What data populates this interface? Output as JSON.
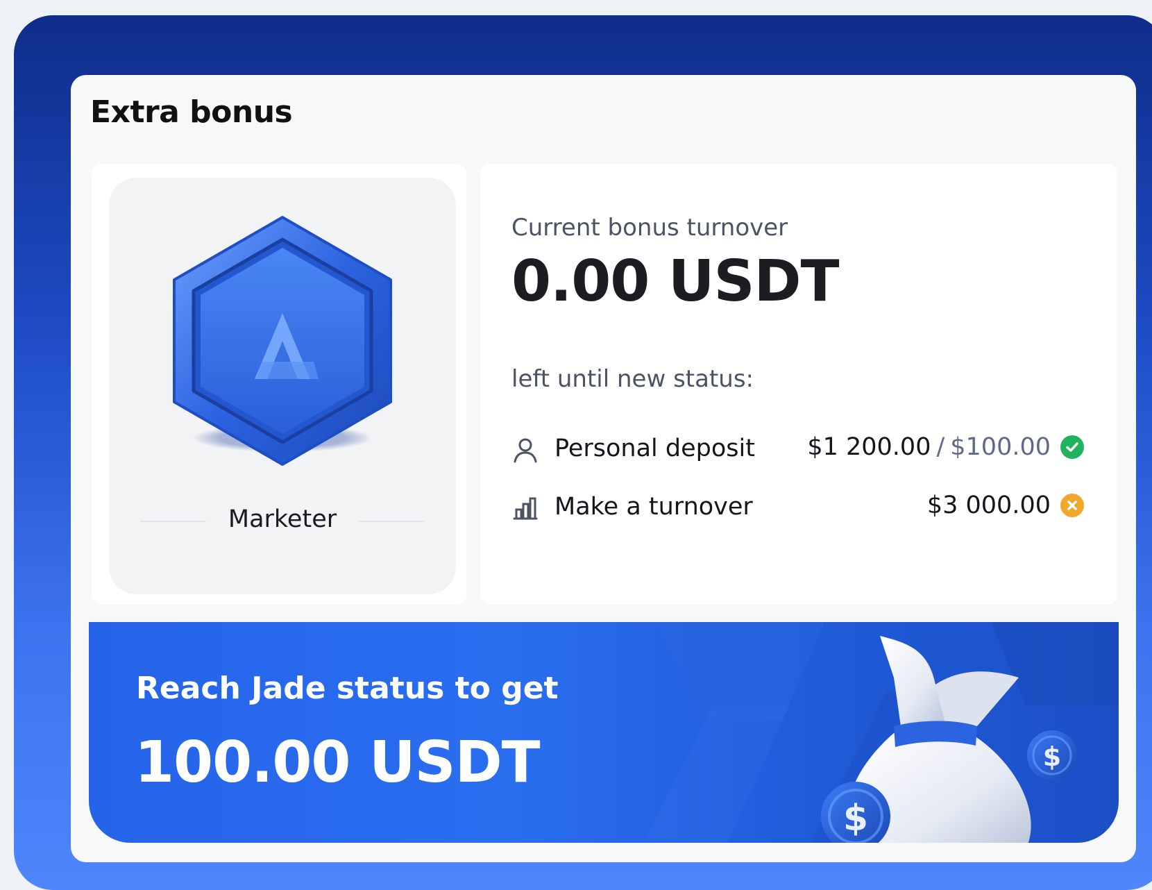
{
  "card": {
    "title": "Extra bonus"
  },
  "status": {
    "name": "Marketer",
    "badge_letter": "A"
  },
  "turnover": {
    "label": "Current bonus turnover",
    "amount": "0.00 USDT",
    "left_label": "left until new status:"
  },
  "requirements": [
    {
      "icon": "user-icon",
      "label": "Personal deposit",
      "current": "$1 200.00",
      "separator": "/",
      "target": "$100.00",
      "status_icon": "check-circle-icon",
      "status_color": "#22b15c"
    },
    {
      "icon": "bar-chart-icon",
      "label": "Make a turnover",
      "current": "$3 000.00",
      "status_icon": "close-circle-icon",
      "status_color": "#f0a82a"
    }
  ],
  "banner": {
    "subtitle": "Reach Jade status to get",
    "amount": "100.00 USDT",
    "coin_symbol": "$"
  },
  "colors": {
    "frame_top": "#0f2d8a",
    "frame_bottom": "#4f86fb",
    "banner": "#2563e9",
    "badge_blue": "#2f6ae6"
  }
}
